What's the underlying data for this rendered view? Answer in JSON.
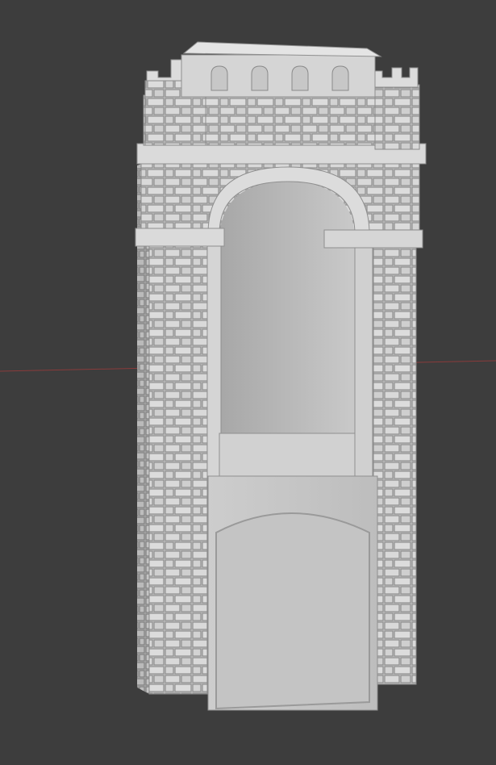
{
  "viewport": {
    "background": "#3d3d3d",
    "axis_color": "#8a3b3b"
  },
  "model": {
    "base_color": "#c9c9c9",
    "shadow_color": "#a9a9a9",
    "light_color": "#e6e6e6",
    "mortar_color": "#8e8e8e"
  }
}
